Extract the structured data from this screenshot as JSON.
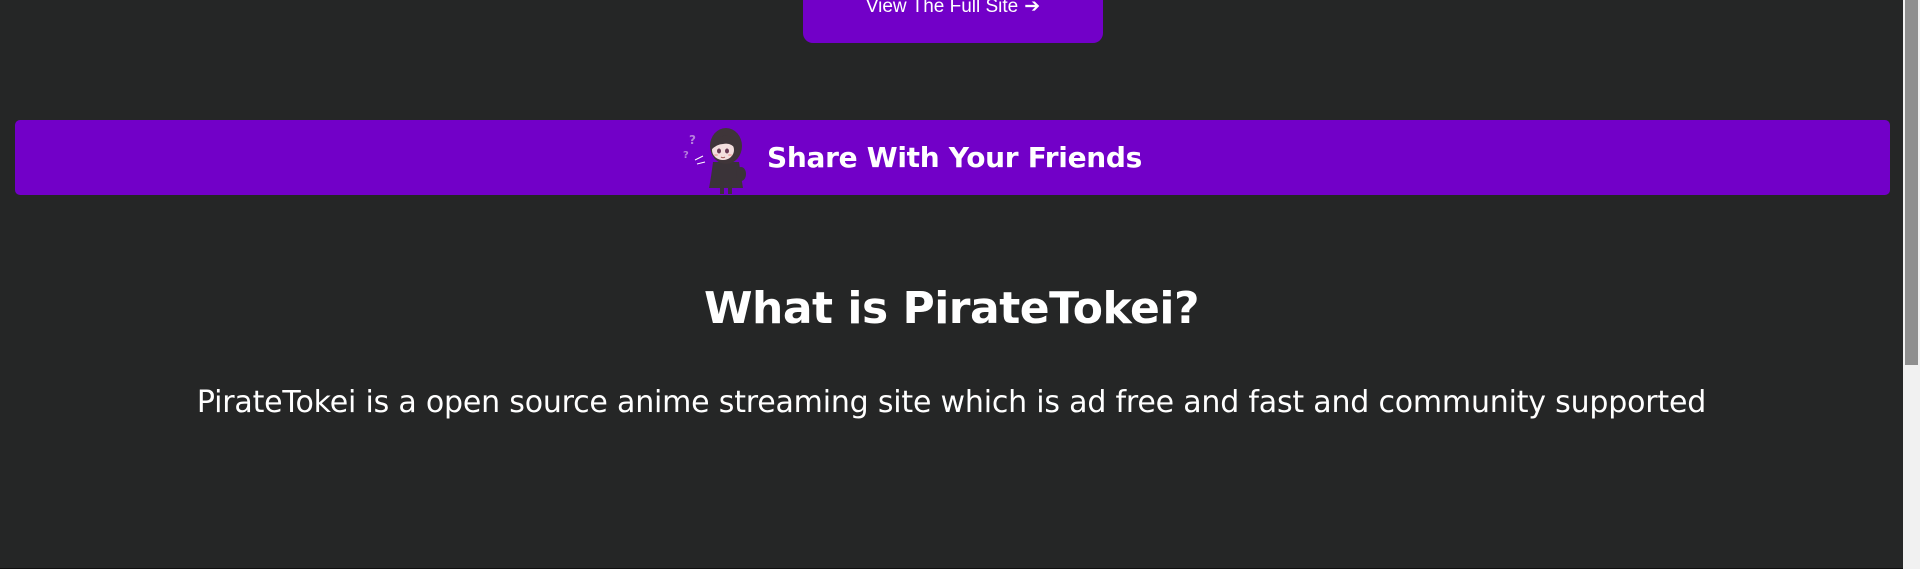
{
  "top_button": {
    "label": "View The Full Site",
    "arrow": "➔"
  },
  "share_banner": {
    "label": "Share With Your Friends",
    "mascot_icon": "chibi-girl-icon"
  },
  "about": {
    "heading": "What is PirateTokei?",
    "description": "PirateTokei is a open source anime streaming site which is ad free and fast and community supported"
  },
  "colors": {
    "background": "#252626",
    "accent": "#7200c8",
    "text": "#ffffff"
  }
}
